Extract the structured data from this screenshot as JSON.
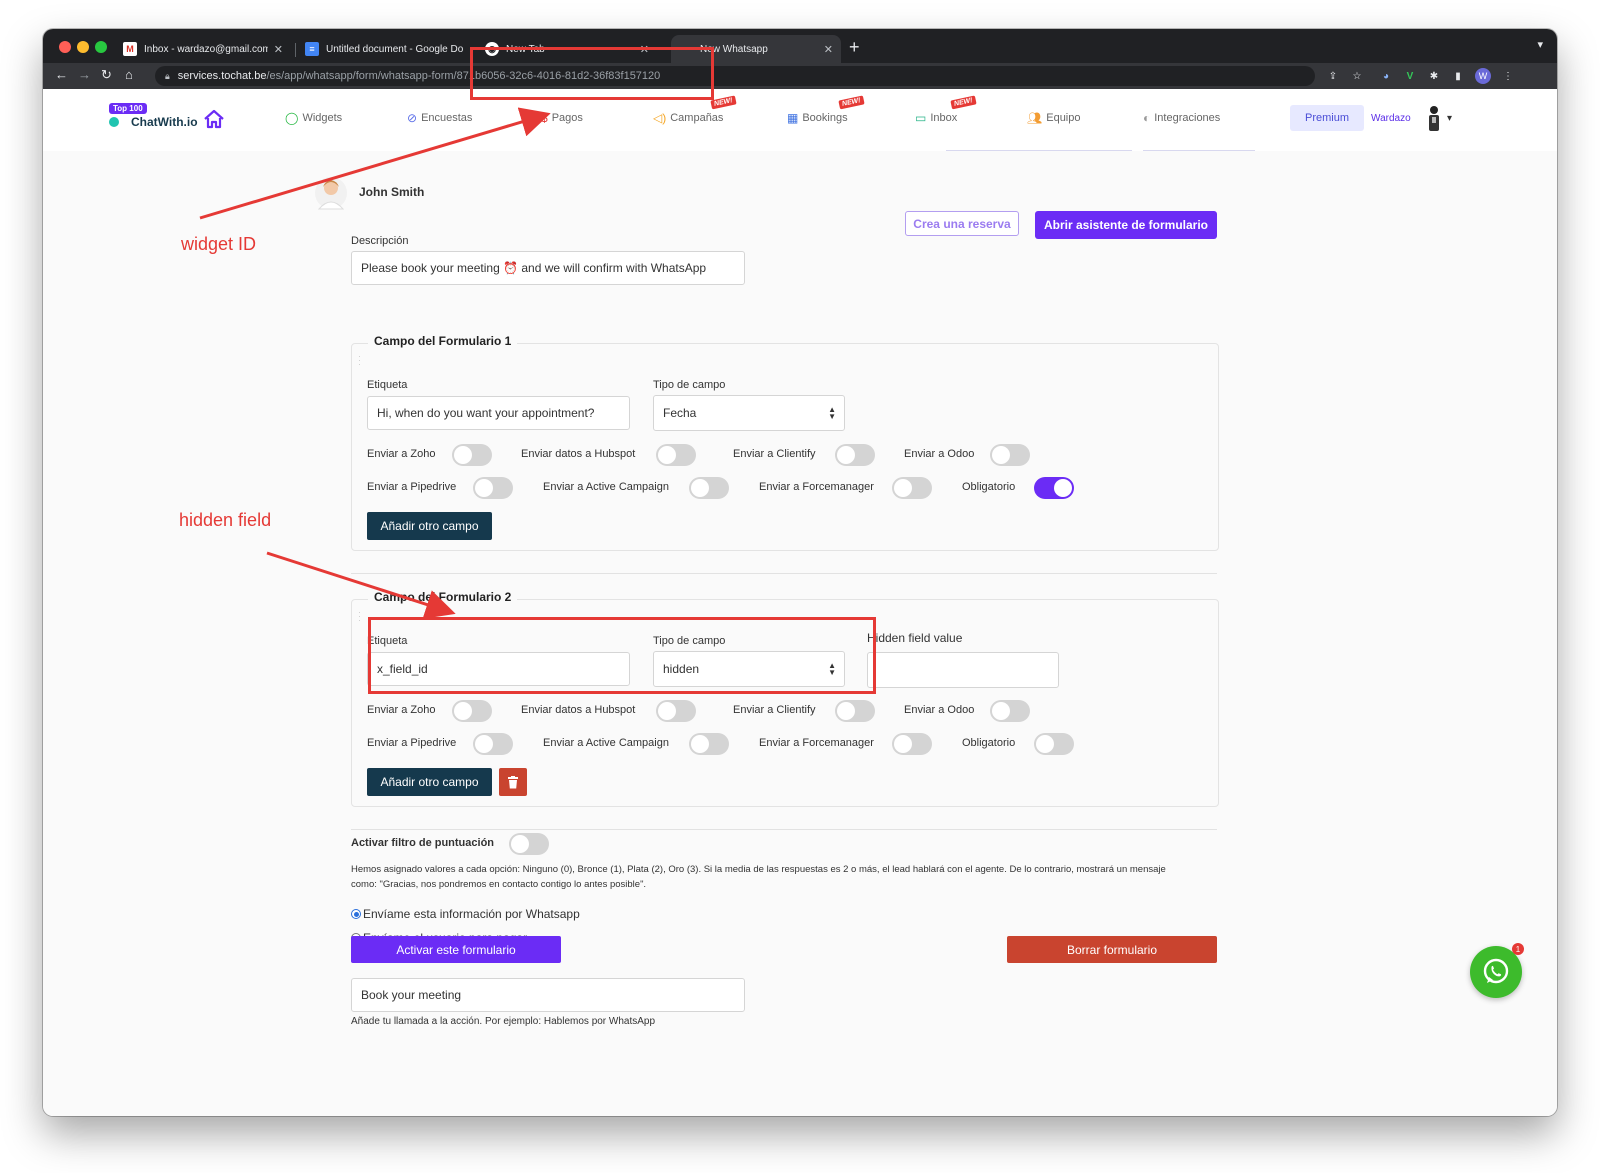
{
  "browser": {
    "tabs": [
      {
        "title": "Inbox - wardazo@gmail.com - G"
      },
      {
        "title": "Untitled document - Google Do"
      },
      {
        "title": "New Tab"
      },
      {
        "title": "New Whatsapp"
      }
    ],
    "url_domain": "services.tochat.be",
    "url_path": "/es/app/whatsapp/form/whatsapp-form/871b6056-32c6-4016-81d2-36f83f157120"
  },
  "app": {
    "logo_badge": "Top 100",
    "logo_name": "ChatWith.io",
    "nav": [
      {
        "label": "Widgets"
      },
      {
        "label": "Encuestas"
      },
      {
        "label": "Pagos"
      },
      {
        "label": "Campañas",
        "badge": "NEW!"
      },
      {
        "label": "Bookings",
        "badge": "NEW!"
      },
      {
        "label": "Inbox",
        "badge": "NEW!"
      },
      {
        "label": "Equipo"
      },
      {
        "label": "Integraciones"
      }
    ],
    "premium_label": "Premium",
    "user_name": "Wardazo"
  },
  "form": {
    "profile_name": "John Smith",
    "reservation_button": "Crea una reserva",
    "wizard_button": "Abrir asistente de formulario",
    "description_label": "Descripción",
    "description_value": "Please book your meeting ⏰ and we will confirm with WhatsApp",
    "fields": [
      {
        "legend": "Campo del Formulario 1",
        "label_caption": "Etiqueta",
        "label_value": "Hi, when do you want your appointment?",
        "type_caption": "Tipo de campo",
        "type_value": "Fecha",
        "toggles": [
          {
            "label": "Enviar a Zoho",
            "on": false
          },
          {
            "label": "Enviar datos a Hubspot",
            "on": false
          },
          {
            "label": "Enviar a Clientify",
            "on": false
          },
          {
            "label": "Enviar a Odoo",
            "on": false
          },
          {
            "label": "Enviar a Pipedrive",
            "on": false
          },
          {
            "label": "Enviar a Active Campaign",
            "on": false
          },
          {
            "label": "Enviar a Forcemanager",
            "on": false
          },
          {
            "label": "Obligatorio",
            "on": true
          }
        ],
        "add_button": "Añadir otro campo"
      },
      {
        "legend": "Campo del Formulario 2",
        "label_caption": "Etiqueta",
        "label_value": "x_field_id",
        "type_caption": "Tipo de campo",
        "type_value": "hidden",
        "hidden_caption": "Hidden field value",
        "hidden_value": "",
        "toggles": [
          {
            "label": "Enviar a Zoho",
            "on": false
          },
          {
            "label": "Enviar datos a Hubspot",
            "on": false
          },
          {
            "label": "Enviar a Clientify",
            "on": false
          },
          {
            "label": "Enviar a Odoo",
            "on": false
          },
          {
            "label": "Enviar a Pipedrive",
            "on": false
          },
          {
            "label": "Enviar a Active Campaign",
            "on": false
          },
          {
            "label": "Enviar a Forcemanager",
            "on": false
          },
          {
            "label": "Obligatorio",
            "on": false
          }
        ],
        "add_button": "Añadir otro campo"
      }
    ],
    "score_filter_label": "Activar filtro de puntuación",
    "score_filter_on": false,
    "score_text": "Hemos asignado valores a cada opción: Ninguno (0), Bronce (1), Plata (2), Oro (3). Si la media de las respuestas es 2 o más, el lead hablará con el agente. De lo contrario, mostrará un mensaje como: \"Gracias, nos pondremos en contacto contigo lo antes posible\".",
    "radio_options": [
      {
        "label": "Envíame esta información por Whatsapp",
        "checked": true
      },
      {
        "label": "Envíame el usuario para pagar",
        "checked": false
      }
    ],
    "cta_value": "Book your meeting",
    "cta_help": "Añade tu llamada a la acción. Por ejemplo: Hablemos por WhatsApp",
    "activate_button": "Activar este formulario",
    "delete_button": "Borrar formulario"
  },
  "whatsapp_badge": "1",
  "annotations": {
    "widget_id_label": "widget ID",
    "hidden_field_label": "hidden field"
  },
  "colors": {
    "accent_purple": "#6b2cf5",
    "dark_button": "#15394d",
    "danger": "#c9442f",
    "annotation_red": "#e53935",
    "whatsapp_green": "#3dbb2c"
  }
}
